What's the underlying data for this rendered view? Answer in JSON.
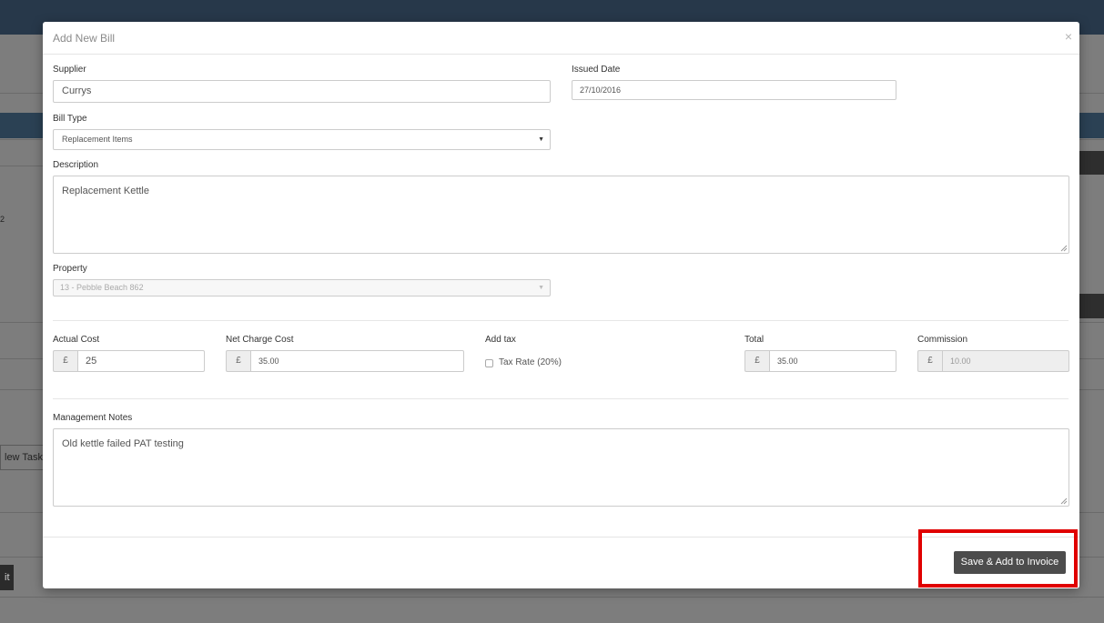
{
  "background": {
    "task_button": "lew Task",
    "left_button": "it",
    "fragment": "2"
  },
  "modal": {
    "title": "Add New Bill",
    "close": "×"
  },
  "form": {
    "supplier_label": "Supplier",
    "supplier_value": "Currys",
    "issued_date_label": "Issued Date",
    "issued_date_value": "27/10/2016",
    "bill_type_label": "Bill Type",
    "bill_type_value": "Replacement Items",
    "description_label": "Description",
    "description_value": "Replacement Kettle",
    "property_label": "Property",
    "property_value": "13 - Pebble Beach 862",
    "actual_cost_label": "Actual Cost",
    "actual_cost_value": "25",
    "net_charge_label": "Net Charge Cost",
    "net_charge_value": "35.00",
    "add_tax_label": "Add tax",
    "tax_rate_label": "Tax Rate (20%)",
    "total_label": "Total",
    "total_value": "35.00",
    "commission_label": "Commission",
    "commission_value": "10.00",
    "currency": "£",
    "management_notes_label": "Management Notes",
    "management_notes_value": "Old kettle failed PAT testing"
  },
  "footer": {
    "save_button": "Save & Add to Invoice"
  },
  "colors": {
    "highlight": "#e00000",
    "button": "#4c4c4c"
  }
}
